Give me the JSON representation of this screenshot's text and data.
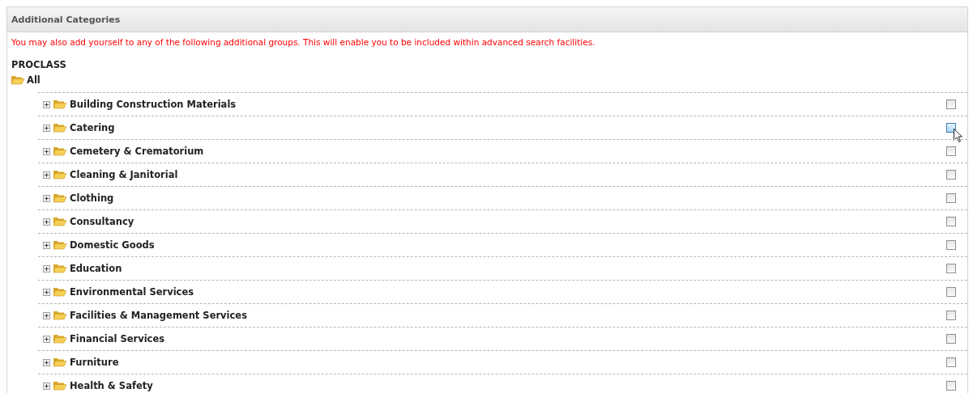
{
  "panel": {
    "title": "Additional Categories"
  },
  "notice": "You may also add yourself to any of the following additional groups. This will enable you to be included within advanced search facilities.",
  "tree": {
    "heading": "PROCLASS",
    "root": {
      "label": "All",
      "children": [
        {
          "label": "Building Construction Materials",
          "expanded": false,
          "checked": false,
          "hovered": false
        },
        {
          "label": "Catering",
          "expanded": false,
          "checked": false,
          "hovered": true
        },
        {
          "label": "Cemetery & Crematorium",
          "expanded": false,
          "checked": false,
          "hovered": false
        },
        {
          "label": "Cleaning & Janitorial",
          "expanded": false,
          "checked": false,
          "hovered": false
        },
        {
          "label": "Clothing",
          "expanded": false,
          "checked": false,
          "hovered": false
        },
        {
          "label": "Consultancy",
          "expanded": false,
          "checked": false,
          "hovered": false
        },
        {
          "label": "Domestic Goods",
          "expanded": false,
          "checked": false,
          "hovered": false
        },
        {
          "label": "Education",
          "expanded": false,
          "checked": false,
          "hovered": false
        },
        {
          "label": "Environmental Services",
          "expanded": false,
          "checked": false,
          "hovered": false
        },
        {
          "label": "Facilities & Management Services",
          "expanded": false,
          "checked": false,
          "hovered": false
        },
        {
          "label": "Financial Services",
          "expanded": false,
          "checked": false,
          "hovered": false
        },
        {
          "label": "Furniture",
          "expanded": false,
          "checked": false,
          "hovered": false
        },
        {
          "label": "Health & Safety",
          "expanded": false,
          "checked": false,
          "hovered": false
        }
      ]
    }
  }
}
